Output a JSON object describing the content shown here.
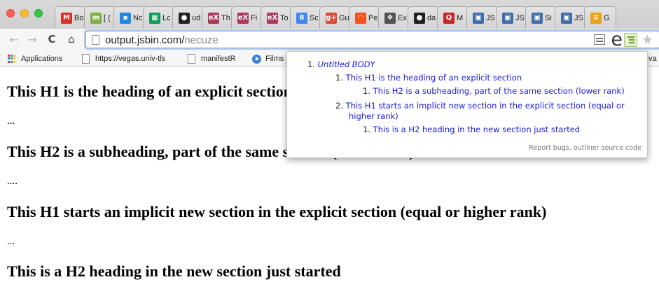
{
  "tabs": [
    {
      "title": "Bo",
      "icon": "gmail-icon",
      "color": "#d93025",
      "glyph": "M"
    },
    {
      "title": "[ (",
      "icon": "mongo-icon",
      "color": "#7cb342",
      "glyph": "m"
    },
    {
      "title": "Nc",
      "icon": "contacts-icon",
      "color": "#1e88e5",
      "glyph": "▪"
    },
    {
      "title": "Lc",
      "icon": "sheets-icon",
      "color": "#0f9d58",
      "glyph": "▦"
    },
    {
      "title": "ud",
      "icon": "github-icon",
      "color": "#222222",
      "glyph": "●"
    },
    {
      "title": "Th",
      "icon": "edx-icon",
      "color": "#ad3a5d",
      "glyph": "eX"
    },
    {
      "title": "Fi",
      "icon": "edx-icon",
      "color": "#ad3a5d",
      "glyph": "eX"
    },
    {
      "title": "To",
      "icon": "edx-icon",
      "color": "#ad3a5d",
      "glyph": "eX"
    },
    {
      "title": "Sc",
      "icon": "google-icon",
      "color": "#4285f4",
      "glyph": "8"
    },
    {
      "title": "Gu",
      "icon": "google-plus-icon",
      "color": "#dd4b39",
      "glyph": "g+"
    },
    {
      "title": "Pe",
      "icon": "rainbow-icon",
      "color": "#f4511e",
      "glyph": "◠"
    },
    {
      "title": "Ex",
      "icon": "puzzle-icon",
      "color": "#555555",
      "glyph": "❖"
    },
    {
      "title": "da",
      "icon": "github-icon",
      "color": "#222222",
      "glyph": "●"
    },
    {
      "title": "M",
      "icon": "quora-icon",
      "color": "#c62828",
      "glyph": "Q"
    },
    {
      "title": "JS",
      "icon": "jsbin-icon",
      "color": "#3f6faa",
      "glyph": "▣"
    },
    {
      "title": "JS",
      "icon": "jsbin-icon",
      "color": "#3f6faa",
      "glyph": "▣"
    },
    {
      "title": "Si",
      "icon": "jsbin-icon",
      "color": "#3f6faa",
      "glyph": "▣"
    },
    {
      "title": "JS",
      "icon": "jsbin-icon",
      "color": "#3f6faa",
      "glyph": "▣"
    },
    {
      "title": "G",
      "icon": "docs-icon",
      "color": "#e8a317",
      "glyph": "≡"
    }
  ],
  "toolbar": {
    "url_host": "output.jsbin.com/",
    "url_path": "necuze"
  },
  "bookmarks": {
    "apps": "Applications",
    "b1": "https://vegas.univ-tls",
    "b2": "manifestR",
    "b3": "Films",
    "overflow": "va"
  },
  "page": {
    "h1_a": "This H1 is the heading of an explicit section",
    "p1": "...",
    "h2_a": "This H2 is a subheading, part of the same section (lower rank)",
    "p2": "....",
    "h1_b": "This H1 starts an implicit new section in the explicit section (equal or higher rank)",
    "p3": "...",
    "h2_b": "This is a H2 heading in the new section just started"
  },
  "outline": {
    "root_num": "1.",
    "root": "Untitled BODY",
    "a_num": "1.",
    "a": "This H1 is the heading of an explicit section",
    "a1_num": "1.",
    "a1": "This H2 is a subheading, part of the same section (lower rank)",
    "b_num": "2.",
    "b_line1": "This H1 starts an implicit new section in the explicit section (equal or",
    "b_line2": "higher rank)",
    "b1_num": "1.",
    "b1": "This is a H2 heading in the new section just started",
    "footer_bugs": "Report bugs",
    "footer_sep": ",",
    "footer_source": "outliner source code"
  }
}
